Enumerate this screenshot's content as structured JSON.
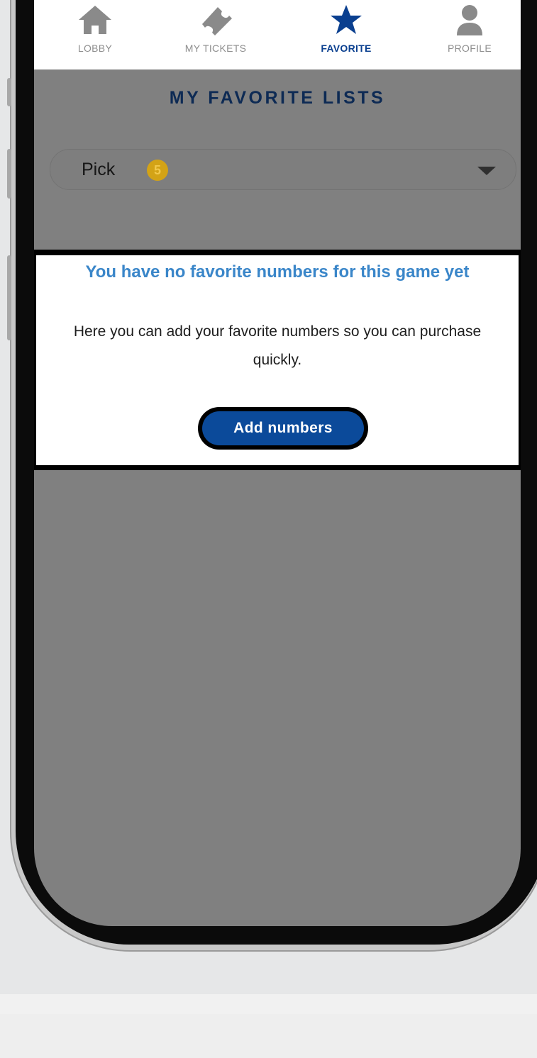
{
  "nav": {
    "items": [
      {
        "label": "LOBBY",
        "icon": "home-icon"
      },
      {
        "label": "MY TICKETS",
        "icon": "ticket-icon"
      },
      {
        "label": "FAVORITE",
        "icon": "star-icon"
      },
      {
        "label": "PROFILE",
        "icon": "profile-icon"
      }
    ],
    "active_color": "#0a3f8f"
  },
  "page": {
    "title": "MY FAVORITE LISTS"
  },
  "game_select": {
    "value": "Pick",
    "badge": "5"
  },
  "empty_state": {
    "title": "You have no favorite numbers for this game yet",
    "body": "Here you can add your favorite numbers so you can purchase quickly.",
    "button_label": "Add numbers"
  }
}
